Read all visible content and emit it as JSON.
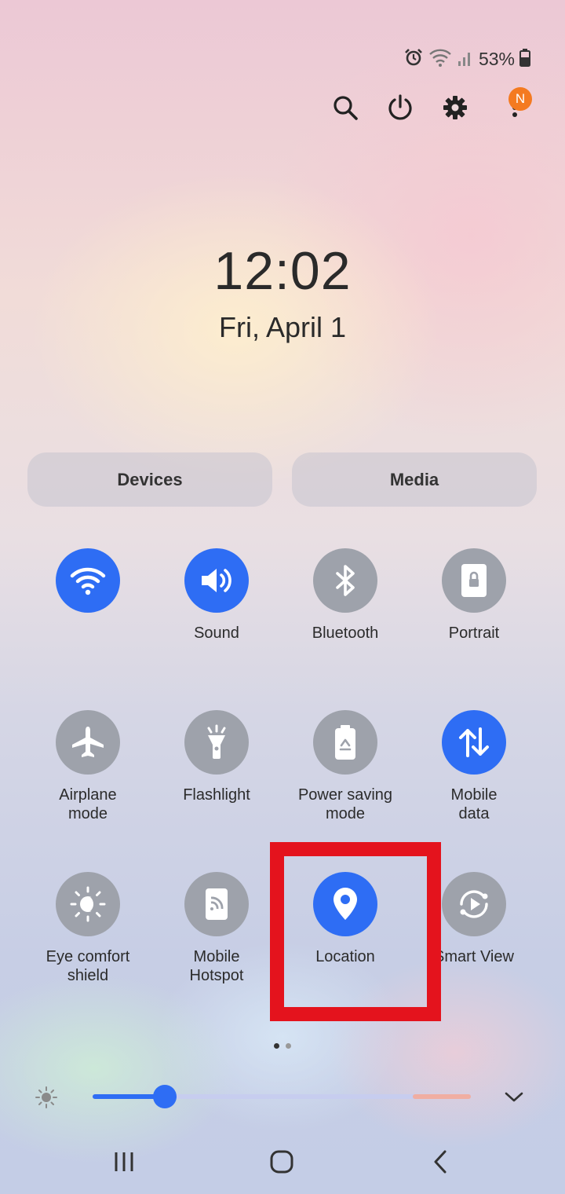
{
  "status_bar": {
    "battery_percent": "53%",
    "icons": [
      "alarm-icon",
      "wifi-icon",
      "signal-icon",
      "battery-icon"
    ]
  },
  "header": {
    "icons": [
      "search-icon",
      "power-icon",
      "settings-icon",
      "more-options-icon"
    ],
    "notification_badge": "N"
  },
  "clock": {
    "time": "12:02",
    "date": "Fri, April 1"
  },
  "panels": {
    "devices_label": "Devices",
    "media_label": "Media"
  },
  "tiles": [
    {
      "label": "",
      "icon": "wifi-icon",
      "state": "on"
    },
    {
      "label": "Sound",
      "icon": "sound-icon",
      "state": "on"
    },
    {
      "label": "Bluetooth",
      "icon": "bluetooth-icon",
      "state": "off"
    },
    {
      "label": "Portrait",
      "icon": "portrait-lock-icon",
      "state": "off"
    },
    {
      "label": "Airplane\nmode",
      "icon": "airplane-icon",
      "state": "off"
    },
    {
      "label": "Flashlight",
      "icon": "flashlight-icon",
      "state": "off"
    },
    {
      "label": "Power saving\nmode",
      "icon": "power-saving-icon",
      "state": "off"
    },
    {
      "label": "Mobile\ndata",
      "icon": "mobile-data-icon",
      "state": "on"
    },
    {
      "label": "Eye comfort\nshield",
      "icon": "eye-comfort-icon",
      "state": "off"
    },
    {
      "label": "Mobile\nHotspot",
      "icon": "hotspot-icon",
      "state": "off"
    },
    {
      "label": "Location",
      "icon": "location-icon",
      "state": "on"
    },
    {
      "label": "Smart View",
      "icon": "smart-view-icon",
      "state": "off"
    }
  ],
  "page_indicator": {
    "pages": 2,
    "current": 1
  },
  "brightness": {
    "level": 0.19
  },
  "nav_bar": {
    "icons": [
      "recents-icon",
      "home-icon",
      "back-icon"
    ]
  },
  "colors": {
    "accent": "#2e6df4",
    "tile_off": "#9ea2ab",
    "highlight": "#e4131d",
    "badge": "#f47a20"
  }
}
